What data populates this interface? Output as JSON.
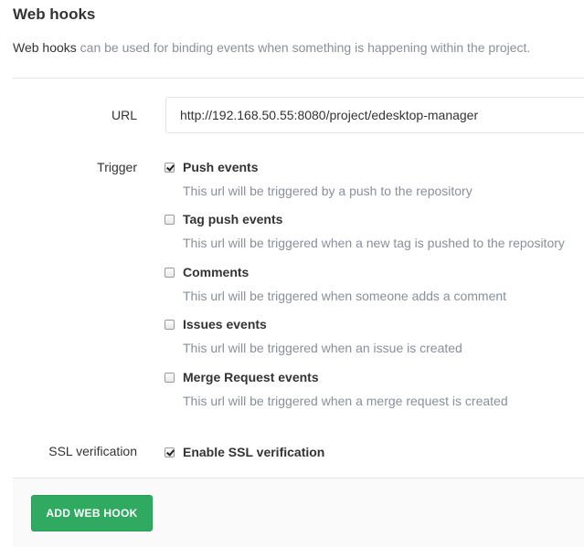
{
  "header": {
    "title": "Web hooks",
    "intro_strong": "Web hooks",
    "intro_rest": " can be used for binding events when something is happening within the project."
  },
  "form": {
    "url_label": "URL",
    "url_value": "http://192.168.50.55:8080/project/edesktop-manager",
    "trigger_label": "Trigger",
    "triggers": [
      {
        "name": "Push events",
        "hint": "This url will be triggered by a push to the repository",
        "checked": true
      },
      {
        "name": "Tag push events",
        "hint": "This url will be triggered when a new tag is pushed to the repository",
        "checked": false
      },
      {
        "name": "Comments",
        "hint": "This url will be triggered when someone adds a comment",
        "checked": false
      },
      {
        "name": "Issues events",
        "hint": "This url will be triggered when an issue is created",
        "checked": false
      },
      {
        "name": "Merge Request events",
        "hint": "This url will be triggered when a merge request is created",
        "checked": false
      }
    ],
    "ssl_label": "SSL verification",
    "ssl_option": {
      "name": "Enable SSL verification",
      "checked": true
    }
  },
  "footer": {
    "submit_label": "ADD WEB HOOK"
  }
}
